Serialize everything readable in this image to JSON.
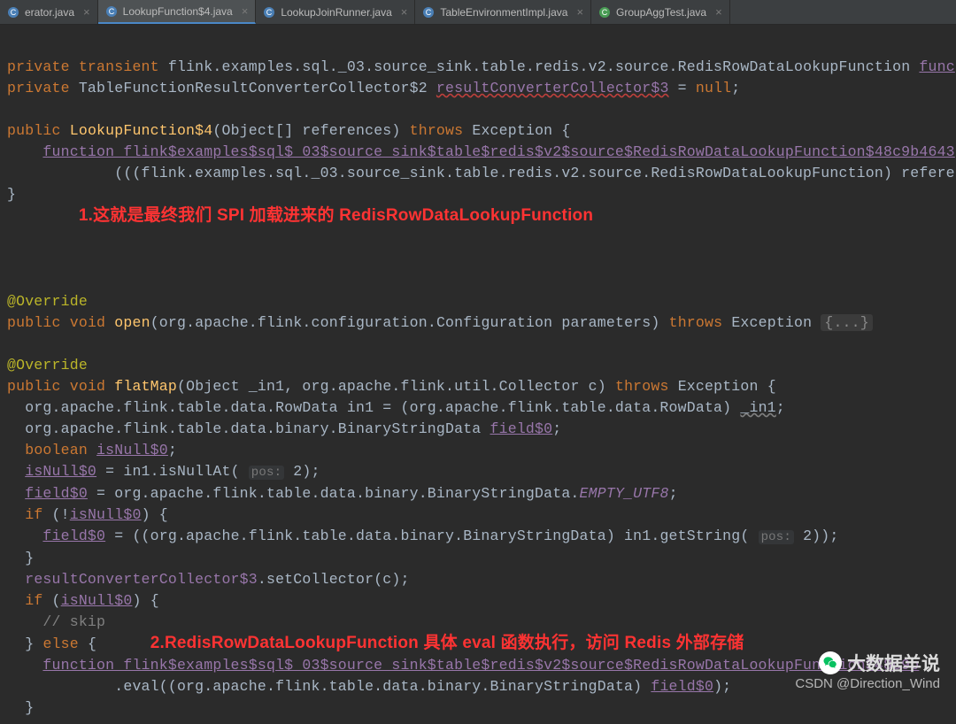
{
  "tabs": [
    {
      "label": "erator.java",
      "icon": "c-icon",
      "active": false
    },
    {
      "label": "LookupFunction$4.java",
      "icon": "c-icon",
      "active": true
    },
    {
      "label": "LookupJoinRunner.java",
      "icon": "c-icon",
      "active": false
    },
    {
      "label": "TableEnvironmentImpl.java",
      "icon": "c-icon",
      "active": false
    },
    {
      "label": "GroupAggTest.java",
      "icon": "c-green-icon",
      "active": false
    }
  ],
  "code": {
    "l1a": "private",
    "l1b": "transient",
    "l1c": "flink.examples.sql._03.source_sink.table.redis.v2.source.RedisRowDataLookupFunction",
    "l1d": "func",
    "l2a": "private",
    "l2b": "TableFunctionResultConverterCollector$2",
    "l2c": "resultConverterCollector$3",
    "l2d": " = ",
    "l2e": "null",
    "l2f": ";",
    "l4a": "public",
    "l4b": "LookupFunction$4",
    "l4c": "(Object[] references) ",
    "l4d": "throws",
    "l4e": " Exception {",
    "l5": "function_flink$examples$sql$_03$source_sink$table$redis$v2$source$RedisRowDataLookupFunction$48c9b4643",
    "l6a": "(((flink.examples.sql._03.source_sink.table.redis.v2.source.RedisRowDataLookupFunction) refere",
    "l7": "}",
    "note1": "1.这就是最终我们 SPI 加载进来的 RedisRowDataLookupFunction",
    "ov": "@Override",
    "l11a": "public",
    "l11b": "void",
    "l11c": "open",
    "l11d": "(org.apache.flink.configuration.Configuration parameters) ",
    "l11e": "throws",
    "l11f": " Exception ",
    "l11g": "{...}",
    "l14a": "public",
    "l14b": "void",
    "l14c": "flatMap",
    "l14d": "(Object _in1, org.apache.flink.util.Collector c) ",
    "l14e": "throws",
    "l14f": " Exception {",
    "l15a": "org.apache.flink.table.data.RowData in1 = (org.apache.flink.table.data.RowData) ",
    "l15b": "_in1",
    "l15c": ";",
    "l16a": "org.apache.flink.table.data.binary.BinaryStringData ",
    "l16b": "field$0",
    "l16c": ";",
    "l17a": "boolean",
    "l17b": " ",
    "l17c": "isNull$0",
    "l17d": ";",
    "l18a": "isNull$0",
    "l18b": " = in1.isNullAt( ",
    "l18h": "pos:",
    "l18c": " 2);",
    "l19a": "field$0",
    "l19b": " = org.apache.flink.table.data.binary.BinaryStringData.",
    "l19c": "EMPTY_UTF8",
    "l19d": ";",
    "l20a": "if",
    "l20b": " (!",
    "l20c": "isNull$0",
    "l20d": ") {",
    "l21a": "field$0",
    "l21b": " = ((org.apache.flink.table.data.binary.BinaryStringData) in1.getString( ",
    "l21h": "pos:",
    "l21c": " 2));",
    "l22": "}",
    "l23a": "resultConverterCollector$3",
    "l23b": ".setCollector(c);",
    "l24a": "if",
    "l24b": " (",
    "l24c": "isNull$0",
    "l24d": ") {",
    "l25": "// skip",
    "l26a": "} ",
    "l26b": "else",
    "l26c": " {",
    "note2": "2.RedisRowDataLookupFunction 具体 eval 函数执行，访问 Redis 外部存储",
    "l27": "function_flink$examples$sql$_03$source_sink$table$redis$v2$source$RedisRowDataLookupFunction$48c9b",
    "l28a": ".eval((org.apache.flink.table.data.binary.BinaryStringData) ",
    "l28b": "field$0",
    "l28c": ");",
    "l29": "}"
  },
  "watermark": {
    "line1": "大数据羊说",
    "line2": "CSDN @Direction_Wind"
  }
}
